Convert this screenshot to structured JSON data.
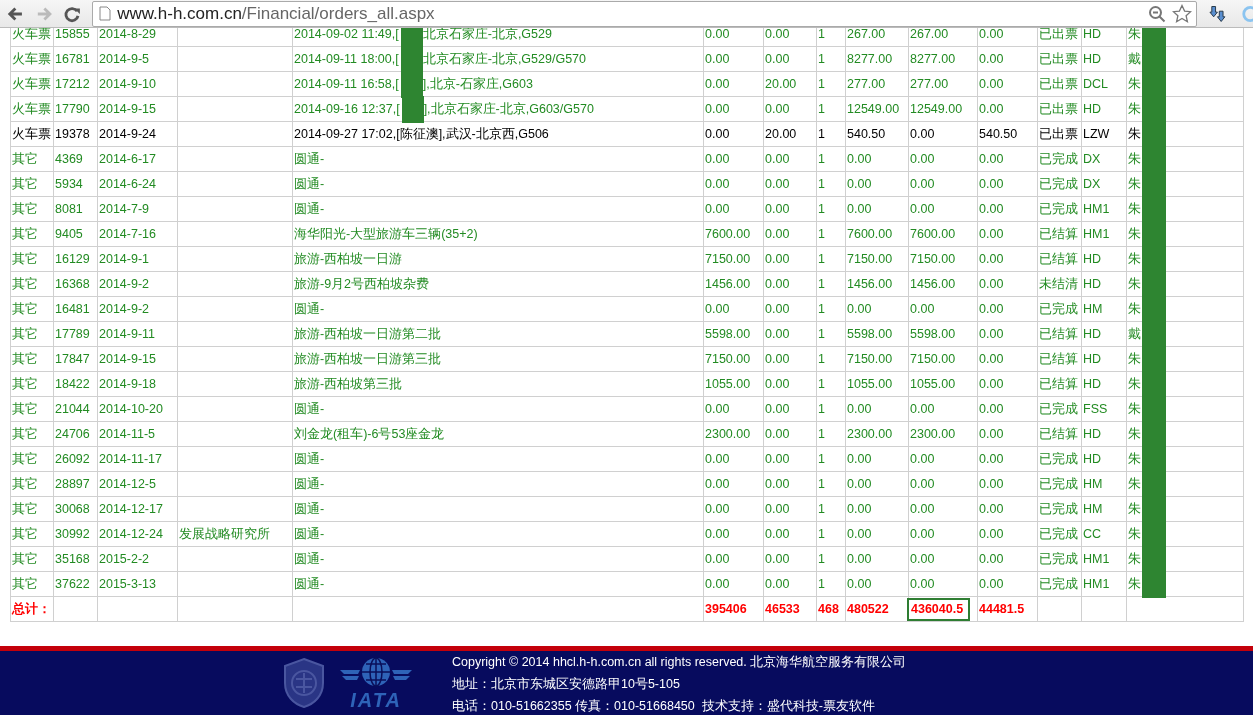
{
  "browser": {
    "forward_disabled": true,
    "url_host": "www.h-h.com.cn",
    "url_path": "/Financial/orders_all.aspx"
  },
  "table": {
    "rows": [
      {
        "color": "#228b22",
        "redacted": true,
        "cells": [
          "火车票",
          "15855",
          "2014-8-29",
          [
            "2014-09-02 11:49,[",
            "北京石家庄-北京,G529"
          ],
          "0.00",
          "0.00",
          "1",
          "267.00",
          "267.00",
          "0.00",
          "已出票",
          "HD",
          "朱"
        ]
      },
      {
        "color": "#228b22",
        "redacted": true,
        "cells": [
          "火车票",
          "16781",
          "2014-9-5",
          [
            "2014-09-11 18:00,[",
            "北京石家庄-北京,G529/G570"
          ],
          "0.00",
          "0.00",
          "1",
          "8277.00",
          "8277.00",
          "0.00",
          "已出票",
          "HD",
          "戴"
        ]
      },
      {
        "color": "#228b22",
        "redacted": true,
        "cells": [
          "火车票",
          "17212",
          "2014-9-10",
          [
            "2014-09-11 16:58,[",
            "],北京-石家庄,G603"
          ],
          "0.00",
          "20.00",
          "1",
          "277.00",
          "277.00",
          "0.00",
          "已出票",
          "DCL",
          "朱"
        ]
      },
      {
        "color": "#228b22",
        "redacted": true,
        "cells": [
          "火车票",
          "17790",
          "2014-9-15",
          [
            "2014-09-16 12:37,[",
            "],北京石家庄-北京,G603/G570"
          ],
          "0.00",
          "0.00",
          "1",
          "12549.00",
          "12549.00",
          "0.00",
          "已出票",
          "HD",
          "朱"
        ]
      },
      {
        "color": "#000000",
        "redacted": true,
        "cells": [
          "火车票",
          "19378",
          "2014-9-24",
          "2014-09-27 17:02,[陈征澳],武汉-北京西,G506",
          "0.00",
          "20.00",
          "1",
          "540.50",
          "0.00",
          "540.50",
          "已出票",
          "LZW",
          "朱"
        ]
      },
      {
        "color": "#228b22",
        "redacted": true,
        "cells": [
          "其它",
          "4369",
          "2014-6-17",
          "圆通-",
          "0.00",
          "0.00",
          "1",
          "0.00",
          "0.00",
          "0.00",
          "已完成",
          "DX",
          "朱"
        ]
      },
      {
        "color": "#228b22",
        "redacted": true,
        "cells": [
          "其它",
          "5934",
          "2014-6-24",
          "圆通-",
          "0.00",
          "0.00",
          "1",
          "0.00",
          "0.00",
          "0.00",
          "已完成",
          "DX",
          "朱"
        ]
      },
      {
        "color": "#228b22",
        "redacted": true,
        "cells": [
          "其它",
          "8081",
          "2014-7-9",
          "圆通-",
          "0.00",
          "0.00",
          "1",
          "0.00",
          "0.00",
          "0.00",
          "已完成",
          "HM1",
          "朱"
        ]
      },
      {
        "color": "#228b22",
        "redacted": true,
        "cells": [
          "其它",
          "9405",
          "2014-7-16",
          "海华阳光-大型旅游车三辆(35+2)",
          "7600.00",
          "0.00",
          "1",
          "7600.00",
          "7600.00",
          "0.00",
          "已结算",
          "HM1",
          "朱"
        ]
      },
      {
        "color": "#228b22",
        "redacted": true,
        "cells": [
          "其它",
          "16129",
          "2014-9-1",
          "旅游-西柏坡一日游",
          "7150.00",
          "0.00",
          "1",
          "7150.00",
          "7150.00",
          "0.00",
          "已结算",
          "HD",
          "朱"
        ]
      },
      {
        "color": "#228b22",
        "redacted": true,
        "cells": [
          "其它",
          "16368",
          "2014-9-2",
          "旅游-9月2号西柏坡杂费",
          "1456.00",
          "0.00",
          "1",
          "1456.00",
          "1456.00",
          "0.00",
          "未结清",
          "HD",
          "朱"
        ]
      },
      {
        "color": "#228b22",
        "redacted": true,
        "cells": [
          "其它",
          "16481",
          "2014-9-2",
          "圆通-",
          "0.00",
          "0.00",
          "1",
          "0.00",
          "0.00",
          "0.00",
          "已完成",
          "HM",
          "朱"
        ]
      },
      {
        "color": "#228b22",
        "redacted": true,
        "cells": [
          "其它",
          "17789",
          "2014-9-11",
          "旅游-西柏坡一日游第二批",
          "5598.00",
          "0.00",
          "1",
          "5598.00",
          "5598.00",
          "0.00",
          "已结算",
          "HD",
          "戴"
        ]
      },
      {
        "color": "#228b22",
        "redacted": true,
        "cells": [
          "其它",
          "17847",
          "2014-9-15",
          "旅游-西柏坡一日游第三批",
          "7150.00",
          "0.00",
          "1",
          "7150.00",
          "7150.00",
          "0.00",
          "已结算",
          "HD",
          "朱"
        ]
      },
      {
        "color": "#228b22",
        "redacted": true,
        "cells": [
          "其它",
          "18422",
          "2014-9-18",
          "旅游-西柏坡第三批",
          "1055.00",
          "0.00",
          "1",
          "1055.00",
          "1055.00",
          "0.00",
          "已结算",
          "HD",
          "朱"
        ]
      },
      {
        "color": "#228b22",
        "redacted": true,
        "cells": [
          "其它",
          "21044",
          "2014-10-20",
          "圆通-",
          "0.00",
          "0.00",
          "1",
          "0.00",
          "0.00",
          "0.00",
          "已完成",
          "FSS",
          "朱"
        ]
      },
      {
        "color": "#228b22",
        "redacted": true,
        "cells": [
          "其它",
          "24706",
          "2014-11-5",
          "刘金龙(租车)-6号53座金龙",
          "2300.00",
          "0.00",
          "1",
          "2300.00",
          "2300.00",
          "0.00",
          "已结算",
          "HD",
          "朱"
        ]
      },
      {
        "color": "#228b22",
        "redacted": true,
        "cells": [
          "其它",
          "26092",
          "2014-11-17",
          "圆通-",
          "0.00",
          "0.00",
          "1",
          "0.00",
          "0.00",
          "0.00",
          "已完成",
          "HD",
          "朱"
        ]
      },
      {
        "color": "#228b22",
        "redacted": true,
        "cells": [
          "其它",
          "28897",
          "2014-12-5",
          "圆通-",
          "0.00",
          "0.00",
          "1",
          "0.00",
          "0.00",
          "0.00",
          "已完成",
          "HM",
          "朱"
        ]
      },
      {
        "color": "#228b22",
        "redacted": true,
        "cells": [
          "其它",
          "30068",
          "2014-12-17",
          "圆通-",
          "0.00",
          "0.00",
          "1",
          "0.00",
          "0.00",
          "0.00",
          "已完成",
          "HM",
          "朱"
        ]
      },
      {
        "color": "#228b22",
        "redacted": true,
        "org": "发展战略研究所",
        "cells": [
          "其它",
          "30992",
          "2014-12-24",
          "圆通-",
          "0.00",
          "0.00",
          "1",
          "0.00",
          "0.00",
          "0.00",
          "已完成",
          "CC",
          "朱"
        ]
      },
      {
        "color": "#228b22",
        "redacted": true,
        "cells": [
          "其它",
          "35168",
          "2015-2-2",
          "圆通-",
          "0.00",
          "0.00",
          "1",
          "0.00",
          "0.00",
          "0.00",
          "已完成",
          "HM1",
          "朱"
        ]
      },
      {
        "color": "#228b22",
        "redacted": true,
        "cells": [
          "其它",
          "37622",
          "2015-3-13",
          "圆通-",
          "0.00",
          "0.00",
          "1",
          "0.00",
          "0.00",
          "0.00",
          "已完成",
          "HM1",
          "朱"
        ]
      }
    ],
    "total": {
      "label": "总计：",
      "values": [
        {
          "text": "395406",
          "selected": false
        },
        {
          "text": "46533",
          "selected": false
        },
        {
          "text": "468",
          "selected": false
        },
        {
          "text": "480522",
          "selected": false
        },
        {
          "text": "436040.5",
          "selected": true
        },
        {
          "text": "44481.5",
          "selected": false
        }
      ]
    }
  },
  "footer": {
    "logo_text": "IATA",
    "lines": [
      "Copyright © 2014 hhcl.h-h.com.cn all rights reserved. 北京海华航空服务有限公司",
      "地址：北京市东城区安德路甲10号5-105",
      "电话：010-51662355 传真：010-51668450  技术支持：盛代科技-票友软件"
    ]
  }
}
